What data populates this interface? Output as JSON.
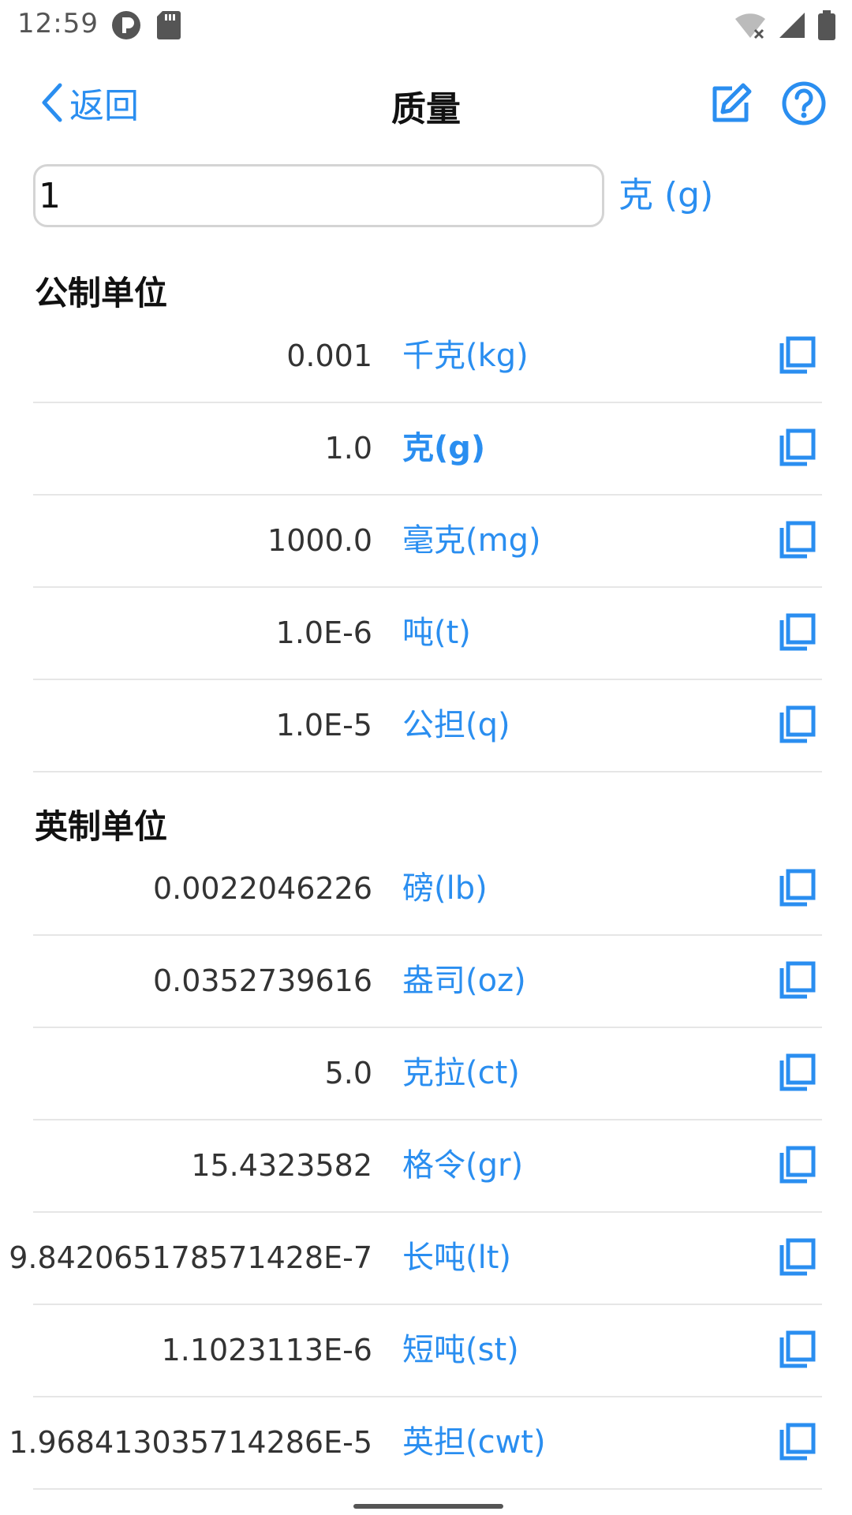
{
  "status": {
    "time": "12:59"
  },
  "nav": {
    "back_label": "返回",
    "title": "质量"
  },
  "input": {
    "value": "1",
    "unit": "克 (g)"
  },
  "sections": [
    {
      "title": "公制单位",
      "rows": [
        {
          "value": "0.001",
          "unit": "千克(kg)"
        },
        {
          "value": "1.0",
          "unit": "克(g)"
        },
        {
          "value": "1000.0",
          "unit": "毫克(mg)"
        },
        {
          "value": "1.0E-6",
          "unit": "吨(t)"
        },
        {
          "value": "1.0E-5",
          "unit": "公担(q)"
        }
      ]
    },
    {
      "title": "英制单位",
      "rows": [
        {
          "value": "0.0022046226",
          "unit": "磅(lb)"
        },
        {
          "value": "0.0352739616",
          "unit": "盎司(oz)"
        },
        {
          "value": "5.0",
          "unit": "克拉(ct)"
        },
        {
          "value": "15.4323582",
          "unit": "格令(gr)"
        },
        {
          "value": "9.842065178571428E-7",
          "unit": "长吨(lt)"
        },
        {
          "value": "1.1023113E-6",
          "unit": "短吨(st)"
        },
        {
          "value": "1.968413035714286E-5",
          "unit": "英担(cwt)"
        }
      ]
    }
  ],
  "icons": {
    "back": "chevron-left-icon",
    "edit": "edit-icon",
    "help": "help-icon",
    "copy": "copy-icon"
  },
  "colors": {
    "accent": "#2a8ef0",
    "divider": "#e6e6e6",
    "text": "#333333"
  }
}
